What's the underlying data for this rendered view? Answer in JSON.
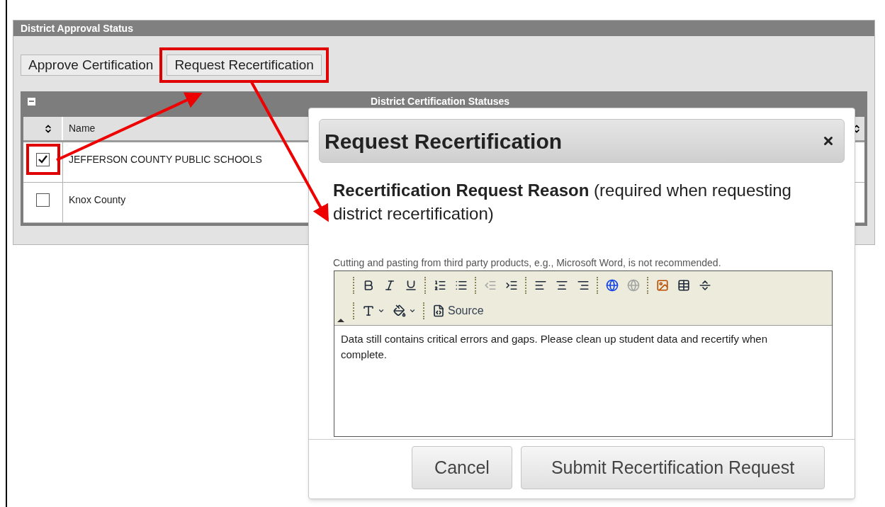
{
  "panel": {
    "title": "District Approval Status"
  },
  "actions": [
    {
      "label": "Approve Certification",
      "highlighted": false
    },
    {
      "label": "Request Recertification",
      "highlighted": true
    }
  ],
  "table": {
    "title": "District Certification Statuses",
    "columns": [
      {
        "label": "Name"
      }
    ],
    "rows": [
      {
        "name": "JEFFERSON COUNTY PUBLIC SCHOOLS",
        "checked": true,
        "highlighted": true
      },
      {
        "name": "Knox County",
        "checked": false,
        "highlighted": false
      }
    ]
  },
  "dialog": {
    "title": "Request Recertification",
    "heading": "**Recertification Request Reason** (required when requesting district recertification)",
    "note": "Cutting and pasting from third party products, e.g., Microsoft Word, is not recommended.",
    "toolbar": {
      "rows": [
        {
          "groups": [
            {
              "tools": [
                {
                  "kind": "bold",
                  "disabled": false
                },
                {
                  "kind": "italic",
                  "disabled": false
                },
                {
                  "kind": "underline",
                  "disabled": false
                }
              ]
            },
            {
              "tools": [
                {
                  "kind": "ordered-list",
                  "disabled": false
                },
                {
                  "kind": "bullet-list",
                  "disabled": false
                }
              ]
            },
            {
              "tools": [
                {
                  "kind": "outdent",
                  "disabled": true
                },
                {
                  "kind": "indent",
                  "disabled": false
                }
              ]
            },
            {
              "tools": [
                {
                  "kind": "align-left",
                  "disabled": false
                },
                {
                  "kind": "align-center",
                  "disabled": false
                },
                {
                  "kind": "align-right",
                  "disabled": false
                }
              ]
            },
            {
              "tools": [
                {
                  "kind": "link",
                  "disabled": false
                },
                {
                  "kind": "unlink",
                  "disabled": true
                }
              ]
            },
            {
              "tools": [
                {
                  "kind": "image",
                  "disabled": false
                },
                {
                  "kind": "table",
                  "disabled": false
                },
                {
                  "kind": "rule",
                  "disabled": false
                }
              ]
            }
          ]
        },
        {
          "groups": [
            {
              "tools": [
                {
                  "kind": "text-color",
                  "disabled": false
                },
                {
                  "kind": "background-color",
                  "disabled": false
                }
              ]
            },
            {
              "tools": [
                {
                  "kind": "source",
                  "label": "Source",
                  "disabled": false
                }
              ]
            }
          ]
        }
      ]
    },
    "body": "Data still contains critical errors and gaps. Please clean up student data and recertify when complete.",
    "buttons": [
      {
        "label": "Cancel",
        "kind": "cancel"
      },
      {
        "label": "Submit Recertification Request",
        "kind": "submit"
      }
    ]
  }
}
